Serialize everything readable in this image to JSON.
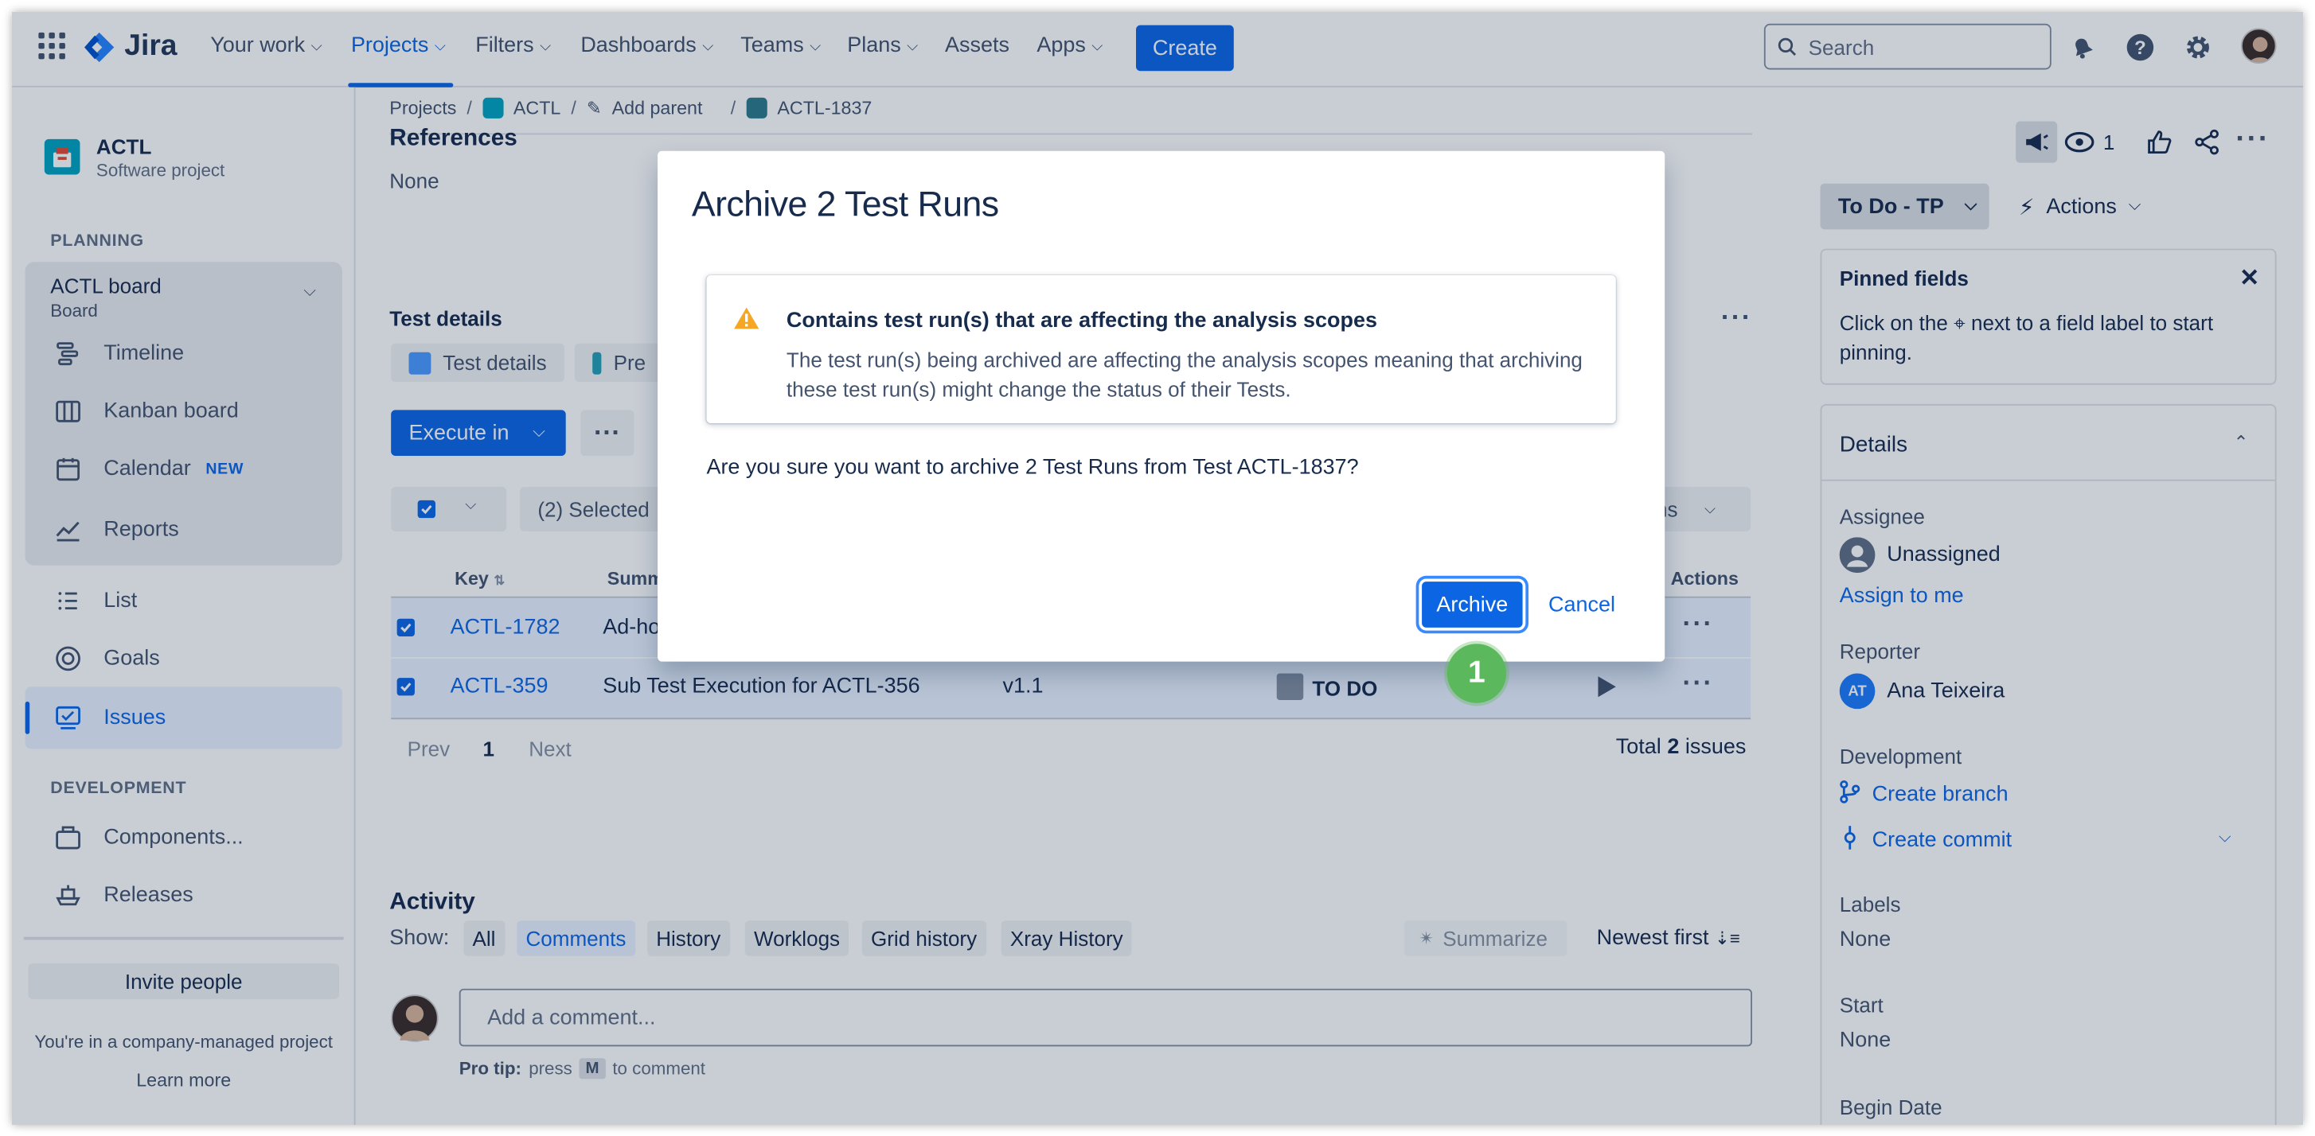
{
  "topnav": {
    "logo": "Jira",
    "items": [
      {
        "label": "Your work"
      },
      {
        "label": "Projects"
      },
      {
        "label": "Filters"
      },
      {
        "label": "Dashboards"
      },
      {
        "label": "Teams"
      },
      {
        "label": "Plans"
      },
      {
        "label": "Assets"
      },
      {
        "label": "Apps"
      }
    ],
    "active": "Projects",
    "create_label": "Create",
    "search_placeholder": "Search"
  },
  "sidebar": {
    "project_name": "ACTL",
    "project_type": "Software project",
    "planning_label": "PLANNING",
    "board_title": "ACTL board",
    "board_sub": "Board",
    "items": [
      {
        "label": "Timeline"
      },
      {
        "label": "Kanban board"
      },
      {
        "label": "Calendar",
        "badge": "NEW"
      },
      {
        "label": "Reports"
      },
      {
        "label": "List"
      },
      {
        "label": "Goals"
      },
      {
        "label": "Issues"
      }
    ],
    "development_label": "DEVELOPMENT",
    "dev_items": [
      {
        "label": "Components..."
      },
      {
        "label": "Releases"
      }
    ],
    "invite_label": "Invite people",
    "company_note": "You're in a company-managed project",
    "learn_more": "Learn more"
  },
  "breadcrumb": {
    "projects": "Projects",
    "project": "ACTL",
    "add_parent": "Add parent",
    "issue": "ACTL-1837"
  },
  "main": {
    "references_title": "References",
    "references_value": "None",
    "test_details_title": "Test details",
    "tab_test_details": "Test details",
    "tab_pre": "Pre",
    "execute_label": "Execute in",
    "selected_label": "(2) Selected",
    "right_seg_label": "ns",
    "columns": {
      "key": "Key",
      "summary": "Summ",
      "actions": "Actions"
    },
    "rows": [
      {
        "key": "ACTL-1782",
        "summary": "Ad-ho",
        "version": "",
        "status": ""
      },
      {
        "key": "ACTL-359",
        "summary": "Sub Test Execution for ACTL-356",
        "version": "v1.1",
        "status": "TO DO"
      }
    ],
    "pager": {
      "prev": "Prev",
      "page": "1",
      "next": "Next"
    },
    "total_prefix": "Total",
    "total_count": "2",
    "total_suffix": "issues"
  },
  "activity": {
    "title": "Activity",
    "show_label": "Show:",
    "chips": [
      {
        "label": "All"
      },
      {
        "label": "Comments"
      },
      {
        "label": "History"
      },
      {
        "label": "Worklogs"
      },
      {
        "label": "Grid history"
      },
      {
        "label": "Xray History"
      }
    ],
    "summarize": "Summarize",
    "sort": "Newest first",
    "comment_placeholder": "Add a comment...",
    "protip_label": "Pro tip:",
    "protip_press": "press",
    "protip_key": "M",
    "protip_rest": "to comment"
  },
  "right_panel": {
    "watch_count": "1",
    "status": "To Do - TP",
    "actions": "Actions",
    "pinned_title": "Pinned fields",
    "pinned_text_a": "Click on the",
    "pinned_text_b": "next to a field label to start pinning.",
    "details_title": "Details",
    "assignee_label": "Assignee",
    "assignee_value": "Unassigned",
    "assign_to_me": "Assign to me",
    "reporter_label": "Reporter",
    "reporter_initials": "AT",
    "reporter_value": "Ana Teixeira",
    "development_label": "Development",
    "create_branch": "Create branch",
    "create_commit": "Create commit",
    "labels_label": "Labels",
    "labels_value": "None",
    "start_label": "Start",
    "start_value": "None",
    "begin_label": "Begin Date"
  },
  "modal": {
    "title": "Archive 2 Test Runs",
    "warning_title": "Contains test run(s) that are affecting the analysis scopes",
    "warning_text": "The test run(s) being archived are affecting the analysis scopes meaning that archiving these test run(s) might change the status of their Tests.",
    "confirm_text": "Are you sure you want to archive 2 Test Runs from Test ACTL-1837?",
    "archive_label": "Archive",
    "cancel_label": "Cancel"
  },
  "step_marker": "1",
  "colors": {
    "brand": "#0C66E4",
    "warning": "#F5A623",
    "marker": "#5cb85c"
  }
}
